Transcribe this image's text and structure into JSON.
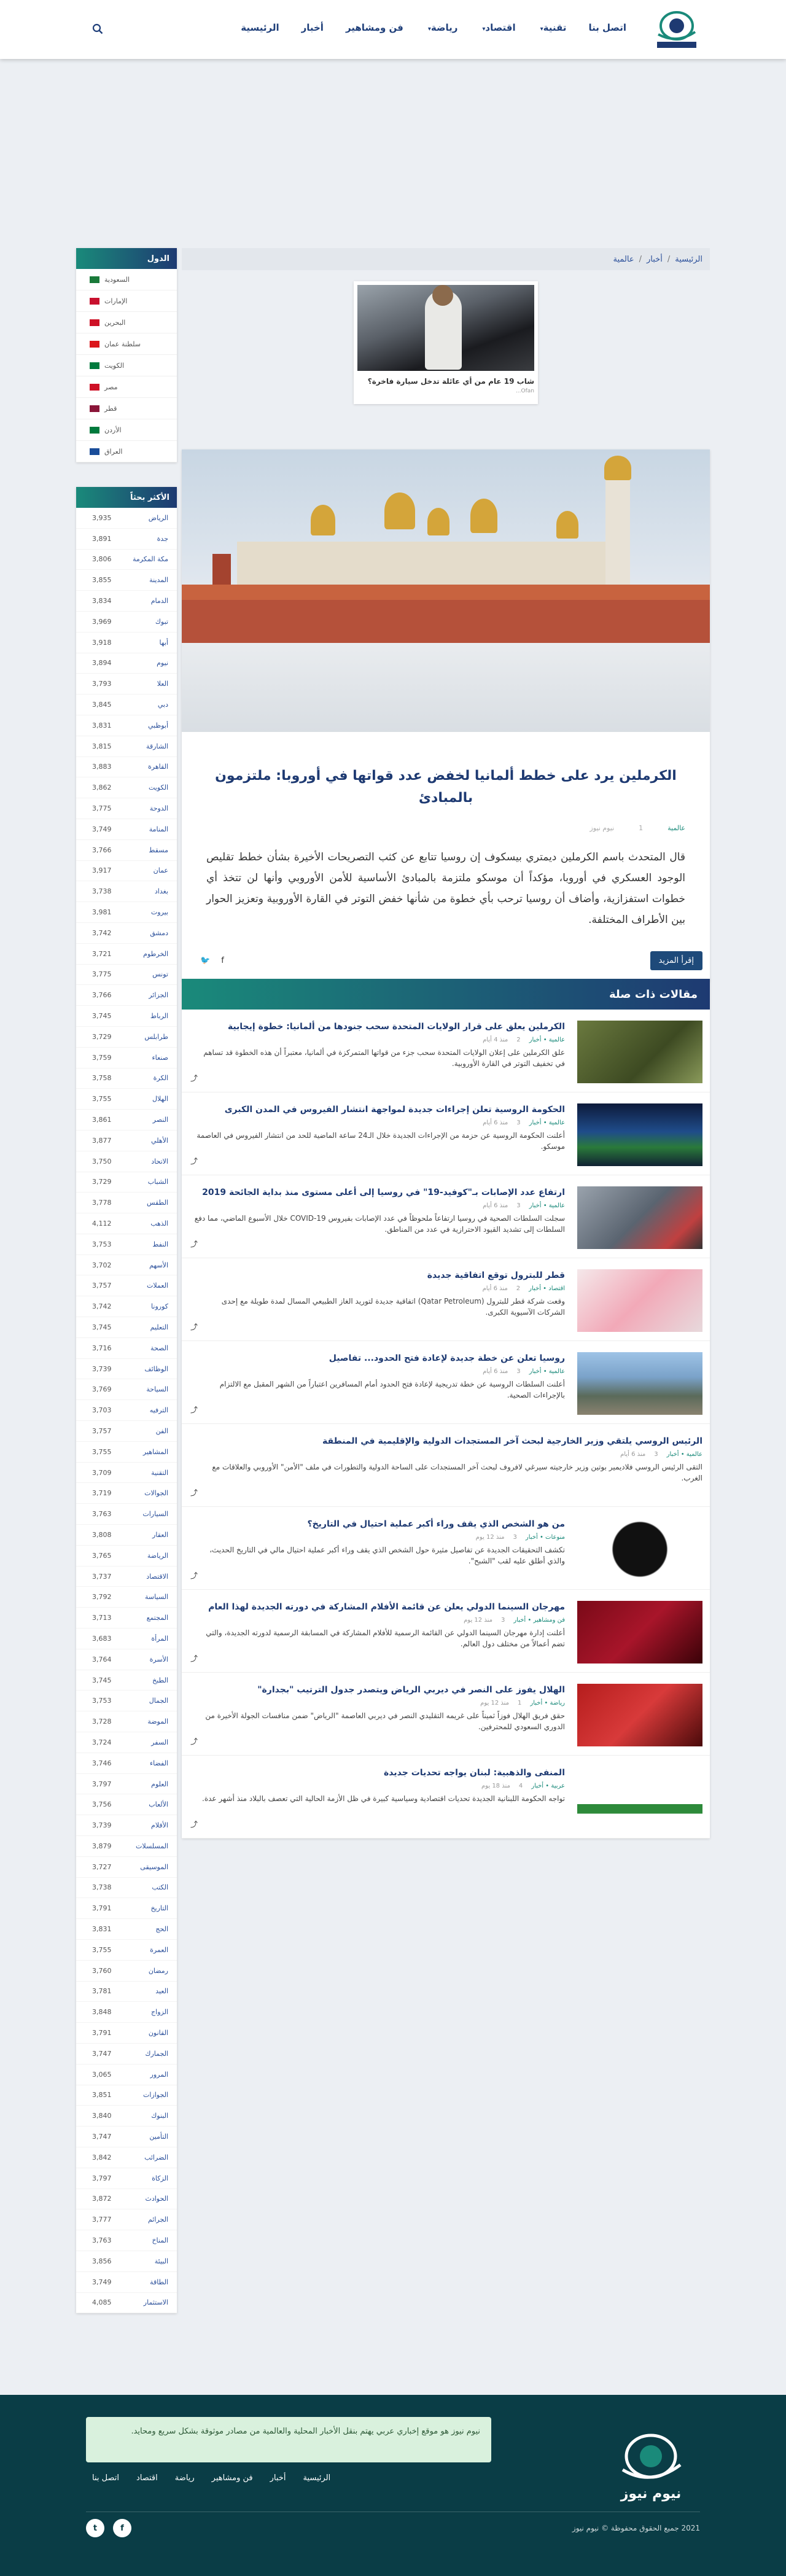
{
  "header": {
    "logo_text": "نيوم نيوز",
    "nav": [
      {
        "label": "اتصل بنا",
        "caret": false
      },
      {
        "label": "تقنية",
        "caret": true
      },
      {
        "label": "اقتصاد",
        "caret": true
      },
      {
        "label": "رياضة",
        "caret": true
      },
      {
        "label": "فن ومشاهير",
        "caret": false
      },
      {
        "label": "أخبار",
        "caret": false
      },
      {
        "label": "الرئيسية",
        "caret": false
      }
    ]
  },
  "breadcrumb": [
    "الرئيسية",
    "أخبار",
    "عالمية"
  ],
  "mini_card": {
    "title": "شاب 19 عام من أي عائلة تدخل سيارة فاخرة؟",
    "source": "Ofan..."
  },
  "sidebar": {
    "countries_title": "الدول",
    "countries": [
      {
        "name": "السعودية",
        "flag": "#1a7a3a"
      },
      {
        "name": "الإمارات",
        "flag": "#c8102e"
      },
      {
        "name": "البحرين",
        "flag": "#ce1126"
      },
      {
        "name": "سلطنة عمان",
        "flag": "#db161b"
      },
      {
        "name": "الكويت",
        "flag": "#007a3d"
      },
      {
        "name": "مصر",
        "flag": "#ce1126"
      },
      {
        "name": "قطر",
        "flag": "#8a1538"
      },
      {
        "name": "الأردن",
        "flag": "#007a3d"
      },
      {
        "name": "العراق",
        "flag": "#1a4d9a"
      }
    ],
    "tags_title": "الأكثر بحثاً",
    "tags": [
      {
        "name": "الرياض",
        "count": "3,935"
      },
      {
        "name": "جدة",
        "count": "3,891"
      },
      {
        "name": "مكة المكرمة",
        "count": "3,806"
      },
      {
        "name": "المدينة",
        "count": "3,855"
      },
      {
        "name": "الدمام",
        "count": "3,834"
      },
      {
        "name": "تبوك",
        "count": "3,969"
      },
      {
        "name": "أبها",
        "count": "3,918"
      },
      {
        "name": "نيوم",
        "count": "3,894"
      },
      {
        "name": "العلا",
        "count": "3,793"
      },
      {
        "name": "دبي",
        "count": "3,845"
      },
      {
        "name": "أبوظبي",
        "count": "3,831"
      },
      {
        "name": "الشارقة",
        "count": "3,815"
      },
      {
        "name": "القاهرة",
        "count": "3,883"
      },
      {
        "name": "الكويت",
        "count": "3,862"
      },
      {
        "name": "الدوحة",
        "count": "3,775"
      },
      {
        "name": "المنامة",
        "count": "3,749"
      },
      {
        "name": "مسقط",
        "count": "3,766"
      },
      {
        "name": "عمان",
        "count": "3,917"
      },
      {
        "name": "بغداد",
        "count": "3,738"
      },
      {
        "name": "بيروت",
        "count": "3,981"
      },
      {
        "name": "دمشق",
        "count": "3,742"
      },
      {
        "name": "الخرطوم",
        "count": "3,721"
      },
      {
        "name": "تونس",
        "count": "3,775"
      },
      {
        "name": "الجزائر",
        "count": "3,766"
      },
      {
        "name": "الرباط",
        "count": "3,745"
      },
      {
        "name": "طرابلس",
        "count": "3,729"
      },
      {
        "name": "صنعاء",
        "count": "3,759"
      },
      {
        "name": "الكرة",
        "count": "3,758"
      },
      {
        "name": "الهلال",
        "count": "3,755"
      },
      {
        "name": "النصر",
        "count": "3,861"
      },
      {
        "name": "الأهلي",
        "count": "3,877"
      },
      {
        "name": "الاتحاد",
        "count": "3,750"
      },
      {
        "name": "الشباب",
        "count": "3,729"
      },
      {
        "name": "الطقس",
        "count": "3,778"
      },
      {
        "name": "الذهب",
        "count": "4,112"
      },
      {
        "name": "النفط",
        "count": "3,753"
      },
      {
        "name": "الأسهم",
        "count": "3,702"
      },
      {
        "name": "العملات",
        "count": "3,757"
      },
      {
        "name": "كورونا",
        "count": "3,742"
      },
      {
        "name": "التعليم",
        "count": "3,745"
      },
      {
        "name": "الصحة",
        "count": "3,716"
      },
      {
        "name": "الوظائف",
        "count": "3,739"
      },
      {
        "name": "السياحة",
        "count": "3,769"
      },
      {
        "name": "الترفيه",
        "count": "3,703"
      },
      {
        "name": "الفن",
        "count": "3,757"
      },
      {
        "name": "المشاهير",
        "count": "3,755"
      },
      {
        "name": "التقنية",
        "count": "3,709"
      },
      {
        "name": "الجوالات",
        "count": "3,719"
      },
      {
        "name": "السيارات",
        "count": "3,763"
      },
      {
        "name": "العقار",
        "count": "3,808"
      },
      {
        "name": "الرياضة",
        "count": "3,765"
      },
      {
        "name": "الاقتصاد",
        "count": "3,737"
      },
      {
        "name": "السياسة",
        "count": "3,792"
      },
      {
        "name": "المجتمع",
        "count": "3,713"
      },
      {
        "name": "المرأة",
        "count": "3,683"
      },
      {
        "name": "الأسرة",
        "count": "3,764"
      },
      {
        "name": "الطبخ",
        "count": "3,745"
      },
      {
        "name": "الجمال",
        "count": "3,753"
      },
      {
        "name": "الموضة",
        "count": "3,728"
      },
      {
        "name": "السفر",
        "count": "3,724"
      },
      {
        "name": "الفضاء",
        "count": "3,746"
      },
      {
        "name": "العلوم",
        "count": "3,797"
      },
      {
        "name": "الألعاب",
        "count": "3,756"
      },
      {
        "name": "الأفلام",
        "count": "3,739"
      },
      {
        "name": "المسلسلات",
        "count": "3,879"
      },
      {
        "name": "الموسيقى",
        "count": "3,727"
      },
      {
        "name": "الكتب",
        "count": "3,738"
      },
      {
        "name": "التاريخ",
        "count": "3,791"
      },
      {
        "name": "الحج",
        "count": "3,831"
      },
      {
        "name": "العمرة",
        "count": "3,755"
      },
      {
        "name": "رمضان",
        "count": "3,760"
      },
      {
        "name": "العيد",
        "count": "3,781"
      },
      {
        "name": "الزواج",
        "count": "3,848"
      },
      {
        "name": "القانون",
        "count": "3,791"
      },
      {
        "name": "الجمارك",
        "count": "3,747"
      },
      {
        "name": "المرور",
        "count": "3,065"
      },
      {
        "name": "الجوازات",
        "count": "3,851"
      },
      {
        "name": "البنوك",
        "count": "3,840"
      },
      {
        "name": "التأمين",
        "count": "3,747"
      },
      {
        "name": "الضرائب",
        "count": "3,842"
      },
      {
        "name": "الزكاة",
        "count": "3,797"
      },
      {
        "name": "الحوادث",
        "count": "3,872"
      },
      {
        "name": "الجرائم",
        "count": "3,777"
      },
      {
        "name": "المناخ",
        "count": "3,763"
      },
      {
        "name": "البيئة",
        "count": "3,856"
      },
      {
        "name": "الطاقة",
        "count": "3,749"
      },
      {
        "name": "الاستثمار",
        "count": "4,085"
      }
    ]
  },
  "article": {
    "title": "الكرملين يرد على خطط ألمانيا لخفض عدد قواتها في أوروبا: ملتزمون بالمبادئ",
    "meta_category": "عالمية",
    "meta_author": "نيوم نيوز",
    "meta_views": "1",
    "body": "قال المتحدث باسم الكرملين ديمتري بيسكوف إن روسيا تتابع عن كثب التصريحات الأخيرة بشأن خطط تقليص الوجود العسكري في أوروبا، مؤكداً أن موسكو ملتزمة بالمبادئ الأساسية للأمن الأوروبي وأنها لن تتخذ أي خطوات استفزازية، وأضاف أن روسيا ترحب بأي خطوة من شأنها خفض التوتر في القارة الأوروبية وتعزيز الحوار بين الأطراف المختلفة.",
    "read_more": "إقرأ المزيد"
  },
  "related": {
    "title": "مقالات ذات صلة",
    "items": [
      {
        "title": "الكرملين يعلق على قرار الولايات المتحدة سحب جنودها من ألمانيا: خطوة إيجابية",
        "category": "عالمية • أخبار",
        "views": "2",
        "date": "منذ 4 أيام",
        "excerpt": "علق الكرملين على إعلان الولايات المتحدة سحب جزء من قواتها المتمركزة في ألمانيا، معتبراً أن هذه الخطوة قد تساهم في تخفيف التوتر في القارة الأوروبية.",
        "thumb": "soldier"
      },
      {
        "title": "الحكومة الروسية تعلن إجراءات جديدة لمواجهة انتشار الفيروس في المدن الكبرى",
        "category": "عالمية • أخبار",
        "views": "3",
        "date": "منذ 6 أيام",
        "excerpt": "أعلنت الحكومة الروسية عن حزمة من الإجراءات الجديدة خلال الـ24 ساعة الماضية للحد من انتشار الفيروس في العاصمة موسكو.",
        "thumb": "stadium"
      },
      {
        "title": "ارتفاع عدد الإصابات بـ\"كوفيد-19\" في روسيا إلى أعلى مستوى منذ بداية الجائحة 2019",
        "category": "عالمية • أخبار",
        "views": "3",
        "date": "منذ 6 أيام",
        "excerpt": "سجلت السلطات الصحية في روسيا ارتفاعاً ملحوظاً في عدد الإصابات بفيروس COVID-19 خلال الأسبوع الماضي، مما دفع السلطات إلى تشديد القيود الاحترازية في عدد من المناطق.",
        "thumb": "masks"
      },
      {
        "title": "قطر للبترول توقع اتفاقية جديدة",
        "category": "اقتصاد • أخبار",
        "views": "2",
        "date": "منذ 6 أيام",
        "excerpt": "وقعت شركة قطر للبترول (Qatar Petroleum) اتفاقية جديدة لتوريد الغاز الطبيعي المسال لمدة طويلة مع إحدى الشركات الآسيوية الكبرى.",
        "thumb": "pig"
      },
      {
        "title": "روسيا تعلن عن خطة جديدة لإعادة فتح الحدود... تفاصيل",
        "category": "عالمية • أخبار",
        "views": "3",
        "date": "منذ 6 أيام",
        "excerpt": "أعلنت السلطات الروسية عن خطة تدريجية لإعادة فتح الحدود أمام المسافرين اعتباراً من الشهر المقبل مع الالتزام بالإجراءات الصحية.",
        "thumb": "street"
      },
      {
        "title": "الرئيس الروسي يلتقي وزير الخارجية لبحث آخر المستجدات الدولية والإقليمية في المنطقة",
        "category": "عالمية • أخبار",
        "views": "3",
        "date": "منذ 6 أيام",
        "excerpt": "التقى الرئيس الروسي فلاديمير بوتين وزير خارجيته سيرغي لافروف لبحث آخر المستجدات على الساحة الدولية والتطورات في ملف \"الأمن\" الأوروبي والعلاقات مع الغرب.",
        "thumb": ""
      },
      {
        "title": "من هو الشخص الذي يقف وراء أكبر عملية احتيال في التاريخ؟",
        "category": "منوعات • أخبار",
        "views": "3",
        "date": "منذ 12 يوم",
        "excerpt": "تكشف التحقيقات الجديدة عن تفاصيل مثيرة حول الشخص الذي يقف وراء أكبر عملية احتيال مالي في التاريخ الحديث، والذي أطلق عليه لقب \"الشبح\".",
        "thumb": "question"
      },
      {
        "title": "مهرجان السينما الدولي يعلن عن قائمة الأفلام المشاركة في دورته الجديدة لهذا العام",
        "category": "فن ومشاهير • أخبار",
        "views": "3",
        "date": "منذ 12 يوم",
        "excerpt": "أعلنت إدارة مهرجان السينما الدولي عن القائمة الرسمية للأفلام المشاركة في المسابقة الرسمية لدورته الجديدة، والتي تضم أعمالاً من مختلف دول العالم.",
        "thumb": "festival"
      },
      {
        "title": "الهلال يفوز على النصر في ديربي الرياض ويتصدر جدول الترتيب \"بجدارة\"",
        "category": "رياضة • أخبار",
        "views": "1",
        "date": "منذ 12 يوم",
        "excerpt": "حقق فريق الهلال فوزاً ثميناً على غريمه التقليدي النصر في ديربي العاصمة \"الرياض\" ضمن منافسات الجولة الأخيرة من الدوري السعودي للمحترفين.",
        "thumb": "fans"
      },
      {
        "title": "المنفى والذهبية: لبنان يواجه تحديات جديدة",
        "category": "عربية • أخبار",
        "views": "4",
        "date": "منذ 18 يوم",
        "excerpt": "تواجه الحكومة اللبنانية الجديدة تحديات اقتصادية وسياسية كبيرة في ظل الأزمة الحالية التي تعصف بالبلاد منذ أشهر عدة.",
        "thumb": "lebanon"
      }
    ]
  },
  "footer": {
    "note": "نيوم نيوز هو موقع إخباري عربي يهتم بنقل الأخبار المحلية والعالمية من مصادر موثوقة بشكل سريع ومحايد.",
    "links": [
      "الرئيسية",
      "أخبار",
      "فن ومشاهير",
      "رياضة",
      "اقتصاد",
      "اتصل بنا"
    ],
    "copyright": "2021 جميع الحقوق محفوظة © نيوم نيوز"
  }
}
